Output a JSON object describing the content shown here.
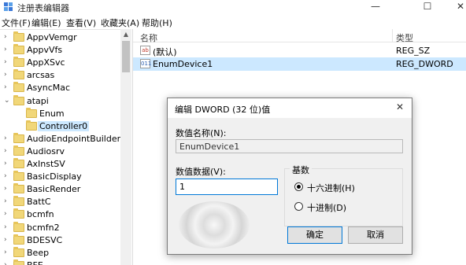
{
  "window": {
    "title": "注册表编辑器",
    "controls": {
      "minimize": "—",
      "maximize": "☐",
      "close": "✕"
    }
  },
  "menu": [
    "文件(F)",
    "编辑(E)",
    "查看(V)",
    "收藏夹(A)",
    "帮助(H)"
  ],
  "tree": {
    "items": [
      {
        "label": "AppvVemgr",
        "expander": "›",
        "selected": false
      },
      {
        "label": "AppvVfs",
        "expander": "›",
        "selected": false
      },
      {
        "label": "AppXSvc",
        "expander": "›",
        "selected": false
      },
      {
        "label": "arcsas",
        "expander": "›",
        "selected": false
      },
      {
        "label": "AsyncMac",
        "expander": "›",
        "selected": false
      },
      {
        "label": "atapi",
        "expander": "⌄",
        "selected": false
      },
      {
        "label": "Enum",
        "expander": "",
        "selected": false
      },
      {
        "label": "Controller0",
        "expander": "",
        "selected": true
      },
      {
        "label": "AudioEndpointBuilder",
        "expander": "›",
        "selected": false
      },
      {
        "label": "Audiosrv",
        "expander": "›",
        "selected": false
      },
      {
        "label": "AxInstSV",
        "expander": "›",
        "selected": false
      },
      {
        "label": "BasicDisplay",
        "expander": "›",
        "selected": false
      },
      {
        "label": "BasicRender",
        "expander": "›",
        "selected": false
      },
      {
        "label": "BattC",
        "expander": "›",
        "selected": false
      },
      {
        "label": "bcmfn",
        "expander": "›",
        "selected": false
      },
      {
        "label": "bcmfn2",
        "expander": "›",
        "selected": false
      },
      {
        "label": "BDESVC",
        "expander": "›",
        "selected": false
      },
      {
        "label": "Beep",
        "expander": "›",
        "selected": false
      },
      {
        "label": "BFE",
        "expander": "›",
        "selected": false
      }
    ]
  },
  "values_pane": {
    "columns": {
      "name": "名称",
      "type": "类型"
    },
    "rows": [
      {
        "icon": "ab",
        "name": "(默认)",
        "type": "REG_SZ",
        "selected": false
      },
      {
        "icon": "011",
        "name": "EnumDevice1",
        "type": "REG_DWORD",
        "selected": true
      }
    ]
  },
  "dialog": {
    "title": "编辑 DWORD (32 位)值",
    "close": "✕",
    "name_label": "数值名称(N):",
    "name_value": "EnumDevice1",
    "data_label": "数值数据(V):",
    "data_value": "1",
    "base_group_label": "基数",
    "radio_hex": "十六进制(H)",
    "radio_dec": "十进制(D)",
    "base_selected": "hex",
    "ok_label": "确定",
    "cancel_label": "取消"
  },
  "colors": {
    "accent": "#0078d7",
    "selection": "#cce8ff",
    "folder": "#f1d779"
  }
}
